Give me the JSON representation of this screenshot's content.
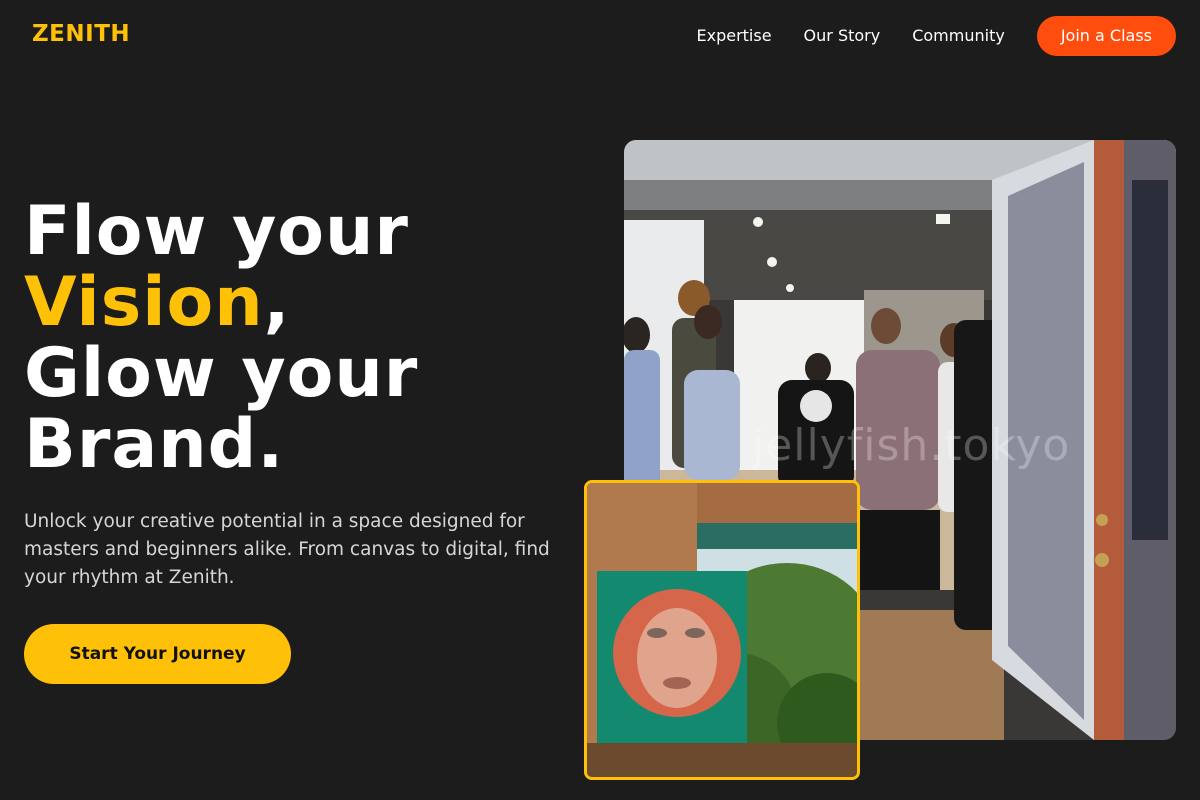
{
  "brand": {
    "name": "ZENITH",
    "accent_color": "#ffc107",
    "cta_color": "#ff4d0d"
  },
  "nav": {
    "links": [
      "Expertise",
      "Our Story",
      "Community"
    ],
    "cta_label": "Join a Class"
  },
  "hero": {
    "title_line1": "Flow your",
    "title_accent": "Vision",
    "title_comma": ",",
    "title_line3": "Glow your",
    "title_line4": "Brand.",
    "description": "Unlock your creative potential in a space designed for masters and beginners alike. From canvas to digital, find your rhythm at Zenith.",
    "cta_label": "Start Your Journey"
  },
  "images": {
    "main_watermark": "jellyfish.tokyo"
  }
}
